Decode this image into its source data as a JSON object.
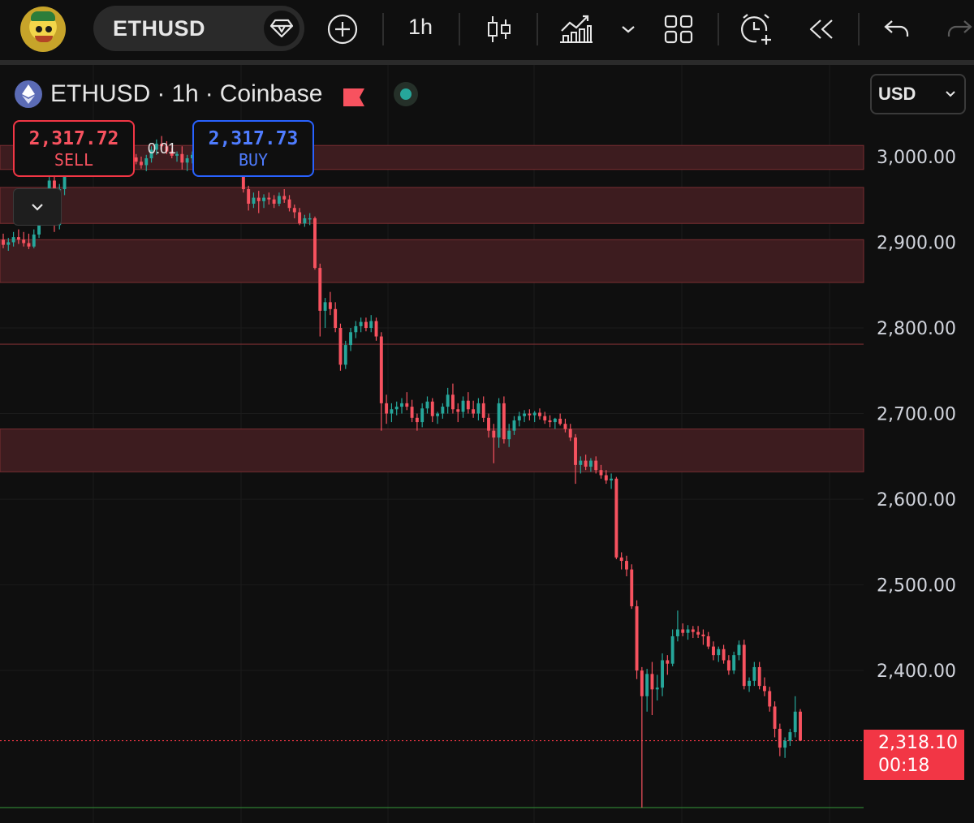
{
  "toolbar": {
    "symbol": "ETHUSD",
    "interval": "1h",
    "icons": [
      "avatar",
      "gem-icon",
      "add-symbol-icon",
      "candles-icon",
      "indicators-icon",
      "chevron-down-icon",
      "layout-grid-icon",
      "alert-clock-icon",
      "replay-icon",
      "undo-icon",
      "redo-icon"
    ]
  },
  "legend": {
    "symbol": "ETHUSD",
    "interval": "1h",
    "exchange": "Coinbase",
    "separator": "·"
  },
  "trade": {
    "sell_price": "2,317.72",
    "sell_label": "SELL",
    "buy_price": "2,317.73",
    "buy_label": "BUY",
    "spread": "0.01"
  },
  "currency": {
    "selected": "USD"
  },
  "last_price": {
    "price": "2,318.10",
    "countdown": "00:18"
  },
  "colors": {
    "up": "#26a69a",
    "down": "#f7525f",
    "zone": "#3d1c1f",
    "zone_border": "#7a2e32",
    "background": "#0f0f0f"
  },
  "chart_data": {
    "type": "candlestick",
    "title": "",
    "symbol": "ETHUSD",
    "interval": "1h",
    "exchange": "Coinbase",
    "currency": "USD",
    "y_axis": {
      "ticks": [
        "3,000.00",
        "2,900.00",
        "2,800.00",
        "2,700.00",
        "2,600.00",
        "2,500.00",
        "2,400.00"
      ],
      "tick_values": [
        3000,
        2900,
        2800,
        2700,
        2600,
        2500,
        2400
      ],
      "range": [
        2222,
        3107
      ],
      "position": "right"
    },
    "grid": true,
    "zones": [
      {
        "from": 2985,
        "to": 3013
      },
      {
        "from": 2922,
        "to": 2964
      },
      {
        "from": 2853,
        "to": 2903
      },
      {
        "from": 2632,
        "to": 2682
      }
    ],
    "lines": [
      {
        "value": 2781,
        "color": "#7a2e32",
        "style": "solid"
      },
      {
        "value": 2318.1,
        "color": "#f23645",
        "style": "dotted"
      },
      {
        "value": 2240,
        "color": "#2e7d32",
        "style": "solid"
      }
    ],
    "last_price": 2318.1,
    "ohlc": [
      [
        2903,
        2910,
        2893,
        2897
      ],
      [
        2897,
        2905,
        2890,
        2900
      ],
      [
        2900,
        2912,
        2895,
        2906
      ],
      [
        2906,
        2915,
        2898,
        2903
      ],
      [
        2903,
        2912,
        2895,
        2899
      ],
      [
        2899,
        2910,
        2892,
        2895
      ],
      [
        2895,
        2915,
        2893,
        2909
      ],
      [
        2909,
        2935,
        2905,
        2930
      ],
      [
        2930,
        2950,
        2925,
        2944
      ],
      [
        2944,
        2978,
        2938,
        2972
      ],
      [
        2972,
        2990,
        2912,
        2920
      ],
      [
        2920,
        2968,
        2915,
        2962
      ],
      [
        2962,
        3000,
        2955,
        2995
      ],
      [
        2995,
        3012,
        2988,
        3003
      ],
      [
        3003,
        3010,
        2996,
        3000
      ],
      [
        3000,
        3005,
        2995,
        2998
      ],
      [
        2998,
        3004,
        2993,
        3001
      ],
      [
        3001,
        3006,
        2996,
        2999
      ],
      [
        2999,
        3003,
        2993,
        2996
      ],
      [
        2996,
        3004,
        2990,
        3002
      ],
      [
        3002,
        3008,
        2998,
        3004
      ],
      [
        3004,
        3009,
        2999,
        3001
      ],
      [
        3001,
        3005,
        2995,
        2998
      ],
      [
        2998,
        3003,
        2992,
        3000
      ],
      [
        3000,
        3006,
        2996,
        3002
      ],
      [
        3002,
        3007,
        2997,
        2999
      ],
      [
        2999,
        3003,
        2991,
        2994
      ],
      [
        2994,
        3000,
        2986,
        2990
      ],
      [
        2990,
        3002,
        2983,
        2998
      ],
      [
        2998,
        3012,
        2993,
        3008
      ],
      [
        3008,
        3020,
        3002,
        3015
      ],
      [
        3015,
        3024,
        3008,
        3012
      ],
      [
        3012,
        3018,
        3003,
        3006
      ],
      [
        3006,
        3010,
        2998,
        3001
      ],
      [
        3001,
        3006,
        2994,
        3003
      ],
      [
        3003,
        3012,
        2985,
        2993
      ],
      [
        2993,
        3002,
        2983,
        2998
      ],
      [
        2998,
        3006,
        2992,
        3002
      ],
      [
        3002,
        3008,
        2996,
        3000
      ],
      [
        3000,
        3006,
        2994,
        3003
      ],
      [
        3003,
        3010,
        2998,
        3005
      ],
      [
        3005,
        3012,
        3000,
        3004
      ],
      [
        3004,
        3012,
        2997,
        3002
      ],
      [
        3002,
        3008,
        2995,
        3000
      ],
      [
        3000,
        3006,
        2994,
        2999
      ],
      [
        2999,
        3002,
        2990,
        2994
      ],
      [
        2994,
        2998,
        2982,
        2984
      ],
      [
        2984,
        2992,
        2958,
        2962
      ],
      [
        2962,
        2966,
        2937,
        2945
      ],
      [
        2945,
        2958,
        2940,
        2952
      ],
      [
        2952,
        2960,
        2934,
        2948
      ],
      [
        2948,
        2956,
        2940,
        2952
      ],
      [
        2952,
        2958,
        2944,
        2950
      ],
      [
        2950,
        2955,
        2940,
        2945
      ],
      [
        2945,
        2958,
        2942,
        2954
      ],
      [
        2954,
        2962,
        2946,
        2950
      ],
      [
        2950,
        2955,
        2936,
        2940
      ],
      [
        2940,
        2944,
        2928,
        2935
      ],
      [
        2935,
        2940,
        2920,
        2922
      ],
      [
        2922,
        2932,
        2918,
        2928
      ],
      [
        2928,
        2934,
        2920,
        2928
      ],
      [
        2928,
        2930,
        2868,
        2870
      ],
      [
        2870,
        2875,
        2790,
        2820
      ],
      [
        2820,
        2835,
        2800,
        2830
      ],
      [
        2830,
        2842,
        2815,
        2822
      ],
      [
        2822,
        2830,
        2795,
        2800
      ],
      [
        2800,
        2805,
        2750,
        2757
      ],
      [
        2757,
        2785,
        2752,
        2780
      ],
      [
        2780,
        2800,
        2773,
        2795
      ],
      [
        2795,
        2808,
        2788,
        2802
      ],
      [
        2802,
        2812,
        2795,
        2807
      ],
      [
        2807,
        2812,
        2796,
        2800
      ],
      [
        2800,
        2815,
        2795,
        2808
      ],
      [
        2808,
        2812,
        2785,
        2790
      ],
      [
        2790,
        2795,
        2680,
        2712
      ],
      [
        2712,
        2722,
        2688,
        2700
      ],
      [
        2700,
        2712,
        2690,
        2705
      ],
      [
        2705,
        2714,
        2698,
        2708
      ],
      [
        2708,
        2718,
        2700,
        2712
      ],
      [
        2712,
        2725,
        2704,
        2708
      ],
      [
        2708,
        2716,
        2690,
        2695
      ],
      [
        2695,
        2700,
        2680,
        2690
      ],
      [
        2690,
        2712,
        2684,
        2706
      ],
      [
        2706,
        2720,
        2700,
        2714
      ],
      [
        2714,
        2718,
        2690,
        2697
      ],
      [
        2697,
        2702,
        2688,
        2700
      ],
      [
        2700,
        2712,
        2694,
        2708
      ],
      [
        2708,
        2730,
        2700,
        2722
      ],
      [
        2722,
        2735,
        2700,
        2705
      ],
      [
        2705,
        2712,
        2690,
        2702
      ],
      [
        2702,
        2720,
        2695,
        2715
      ],
      [
        2715,
        2725,
        2700,
        2705
      ],
      [
        2705,
        2715,
        2695,
        2700
      ],
      [
        2700,
        2718,
        2692,
        2712
      ],
      [
        2712,
        2720,
        2690,
        2695
      ],
      [
        2695,
        2700,
        2672,
        2680
      ],
      [
        2680,
        2688,
        2642,
        2672
      ],
      [
        2672,
        2718,
        2660,
        2712
      ],
      [
        2712,
        2720,
        2665,
        2670
      ],
      [
        2670,
        2688,
        2661,
        2680
      ],
      [
        2680,
        2697,
        2675,
        2692
      ],
      [
        2692,
        2702,
        2685,
        2697
      ],
      [
        2697,
        2704,
        2690,
        2700
      ],
      [
        2700,
        2705,
        2692,
        2698
      ],
      [
        2698,
        2703,
        2690,
        2701
      ],
      [
        2701,
        2706,
        2693,
        2697
      ],
      [
        2697,
        2702,
        2688,
        2692
      ],
      [
        2692,
        2698,
        2684,
        2690
      ],
      [
        2690,
        2695,
        2682,
        2694
      ],
      [
        2694,
        2700,
        2686,
        2688
      ],
      [
        2688,
        2694,
        2678,
        2682
      ],
      [
        2682,
        2688,
        2668,
        2672
      ],
      [
        2672,
        2676,
        2618,
        2640
      ],
      [
        2640,
        2650,
        2630,
        2645
      ],
      [
        2645,
        2652,
        2634,
        2638
      ],
      [
        2638,
        2648,
        2632,
        2645
      ],
      [
        2645,
        2650,
        2630,
        2634
      ],
      [
        2634,
        2640,
        2624,
        2628
      ],
      [
        2628,
        2634,
        2618,
        2622
      ],
      [
        2622,
        2630,
        2612,
        2624
      ],
      [
        2624,
        2626,
        2530,
        2532
      ],
      [
        2532,
        2538,
        2518,
        2528
      ],
      [
        2528,
        2534,
        2510,
        2518
      ],
      [
        2518,
        2524,
        2472,
        2475
      ],
      [
        2475,
        2482,
        2390,
        2400
      ],
      [
        2400,
        2404,
        2240,
        2370
      ],
      [
        2370,
        2402,
        2352,
        2396
      ],
      [
        2396,
        2410,
        2348,
        2378
      ],
      [
        2378,
        2395,
        2365,
        2380
      ],
      [
        2380,
        2420,
        2370,
        2412
      ],
      [
        2412,
        2418,
        2395,
        2408
      ],
      [
        2408,
        2448,
        2405,
        2440
      ],
      [
        2440,
        2470,
        2434,
        2448
      ],
      [
        2448,
        2455,
        2440,
        2444
      ],
      [
        2444,
        2453,
        2436,
        2448
      ],
      [
        2448,
        2452,
        2438,
        2445
      ],
      [
        2445,
        2452,
        2438,
        2442
      ],
      [
        2442,
        2448,
        2430,
        2440
      ],
      [
        2440,
        2445,
        2425,
        2428
      ],
      [
        2428,
        2434,
        2412,
        2418
      ],
      [
        2418,
        2428,
        2410,
        2425
      ],
      [
        2425,
        2430,
        2408,
        2412
      ],
      [
        2412,
        2418,
        2395,
        2400
      ],
      [
        2400,
        2422,
        2396,
        2418
      ],
      [
        2418,
        2435,
        2412,
        2430
      ],
      [
        2430,
        2436,
        2378,
        2382
      ],
      [
        2382,
        2392,
        2375,
        2388
      ],
      [
        2388,
        2410,
        2382,
        2404
      ],
      [
        2404,
        2410,
        2378,
        2382
      ],
      [
        2382,
        2392,
        2370,
        2376
      ],
      [
        2376,
        2381,
        2352,
        2358
      ],
      [
        2358,
        2364,
        2322,
        2332
      ],
      [
        2332,
        2338,
        2300,
        2310
      ],
      [
        2310,
        2322,
        2298,
        2318
      ],
      [
        2318,
        2332,
        2312,
        2328
      ],
      [
        2328,
        2370,
        2322,
        2352
      ],
      [
        2352,
        2355,
        2318,
        2318.1
      ]
    ]
  }
}
